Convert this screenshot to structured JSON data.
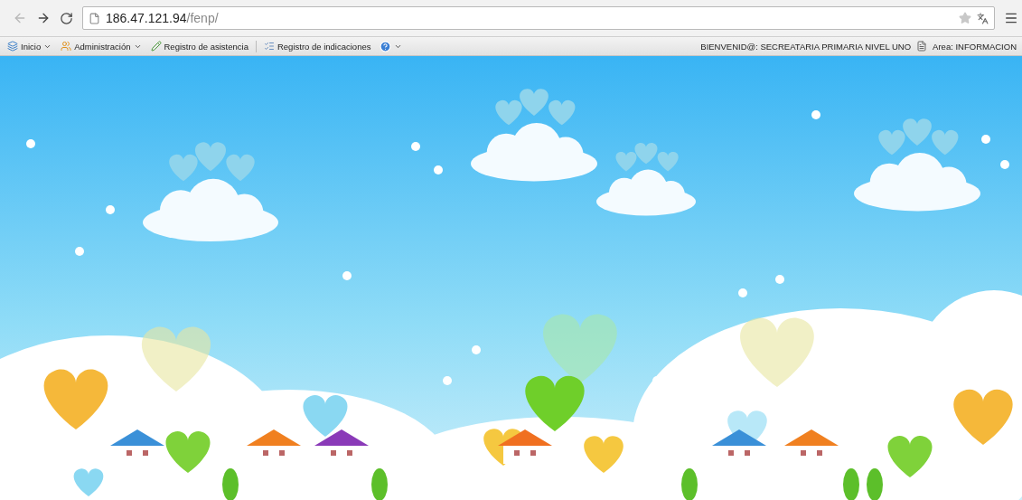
{
  "browser": {
    "address_host": "186.47.121.94",
    "address_path": "/fenp/"
  },
  "menu": [
    {
      "label": "Inicio",
      "kind": "dropdown"
    },
    {
      "label": "Administración",
      "kind": "dropdown"
    },
    {
      "label": "Registro de asistencia",
      "kind": "link"
    },
    {
      "label": "Registro de indicaciones",
      "kind": "link"
    },
    {
      "kind": "help"
    }
  ],
  "user": {
    "welcome": "BIENVENID@: SECREATARIA PRIMARIA NIVEL UNO",
    "area": "Area: INFORMACION"
  }
}
